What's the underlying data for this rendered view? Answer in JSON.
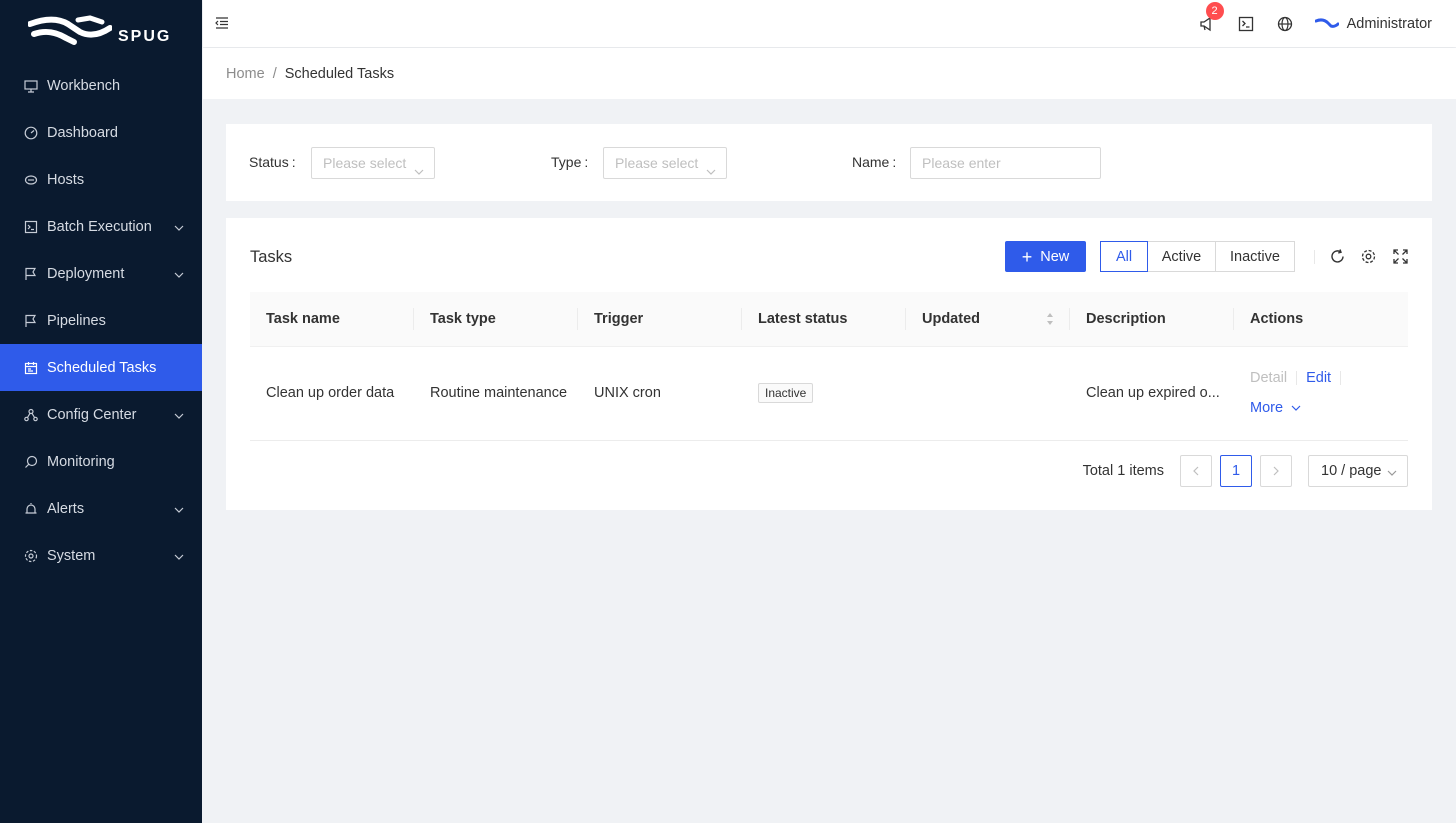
{
  "brand": {
    "name": "SPUG"
  },
  "sidebar": {
    "items": [
      {
        "label": "Workbench",
        "icon": "desktop-icon",
        "has_children": false
      },
      {
        "label": "Dashboard",
        "icon": "dashboard-icon",
        "has_children": false
      },
      {
        "label": "Hosts",
        "icon": "cloud-server-icon",
        "has_children": false
      },
      {
        "label": "Batch Execution",
        "icon": "code-icon",
        "has_children": true
      },
      {
        "label": "Deployment",
        "icon": "flag-icon",
        "has_children": true
      },
      {
        "label": "Pipelines",
        "icon": "flag-icon",
        "has_children": false
      },
      {
        "label": "Scheduled Tasks",
        "icon": "schedule-icon",
        "has_children": false,
        "active": true
      },
      {
        "label": "Config Center",
        "icon": "deployment-unit-icon",
        "has_children": true
      },
      {
        "label": "Monitoring",
        "icon": "monitor-icon",
        "has_children": false
      },
      {
        "label": "Alerts",
        "icon": "alert-icon",
        "has_children": true
      },
      {
        "label": "System",
        "icon": "setting-icon",
        "has_children": true
      }
    ]
  },
  "header": {
    "notification_count": "2",
    "user_name": "Administrator"
  },
  "breadcrumb": {
    "home": "Home",
    "separator": "/",
    "current": "Scheduled Tasks"
  },
  "filters": {
    "status_label": "Status",
    "status_placeholder": "Please select",
    "type_label": "Type",
    "type_placeholder": "Please select",
    "name_label": "Name",
    "name_placeholder": "Please enter",
    "colon": ":"
  },
  "tasks_card": {
    "title": "Tasks",
    "new_button": "New",
    "segments": [
      "All",
      "Active",
      "Inactive"
    ],
    "active_segment": "All"
  },
  "table": {
    "columns": [
      "Task name",
      "Task type",
      "Trigger",
      "Latest status",
      "Updated",
      "Description",
      "Actions"
    ],
    "rows": [
      {
        "task_name": "Clean up order data",
        "task_type": "Routine maintenance",
        "trigger": "UNIX cron",
        "latest_status": "Inactive",
        "updated": "",
        "description": "Clean up expired o...",
        "actions": {
          "detail": "Detail",
          "edit": "Edit",
          "more": "More"
        }
      }
    ]
  },
  "pagination": {
    "total_text": "Total 1 items",
    "current_page": "1",
    "page_size": "10 / page"
  },
  "colors": {
    "primary": "#2f5bea",
    "sidebar_bg": "#0a1a2f",
    "badge": "#ff4d4f"
  }
}
